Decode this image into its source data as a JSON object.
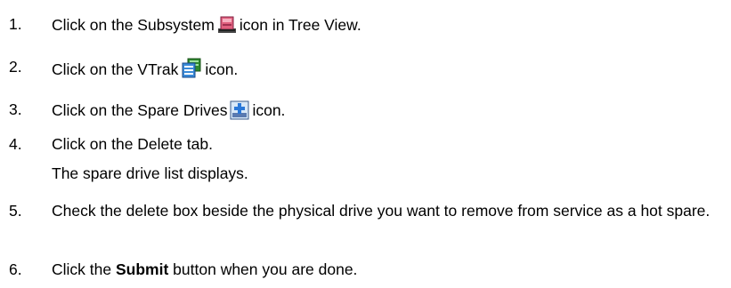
{
  "steps": [
    {
      "number": "1.",
      "before": "Click on the Subsystem",
      "icon": "subsystem-icon",
      "after": "icon in Tree View."
    },
    {
      "number": "2.",
      "before": "Click on the VTrak",
      "icon": "vtrak-icon",
      "after": "icon."
    },
    {
      "number": "3.",
      "before": "Click on the Spare Drives",
      "icon": "spare-drives-icon",
      "after": "icon."
    },
    {
      "number": "4.",
      "text": "Click on the Delete tab.",
      "note": "The spare drive list displays."
    },
    {
      "number": "5.",
      "text": "Check the delete box beside the physical drive you want to remove from service as a hot spare."
    },
    {
      "number": "6.",
      "before": "Click the",
      "bold": "Submit",
      "after": "button when you are done."
    }
  ],
  "colors": {
    "subsystem_icon": "#e0607e",
    "vtrak_icon": "#3a9a3a",
    "spare_drives_icon": "#3a78c8"
  }
}
